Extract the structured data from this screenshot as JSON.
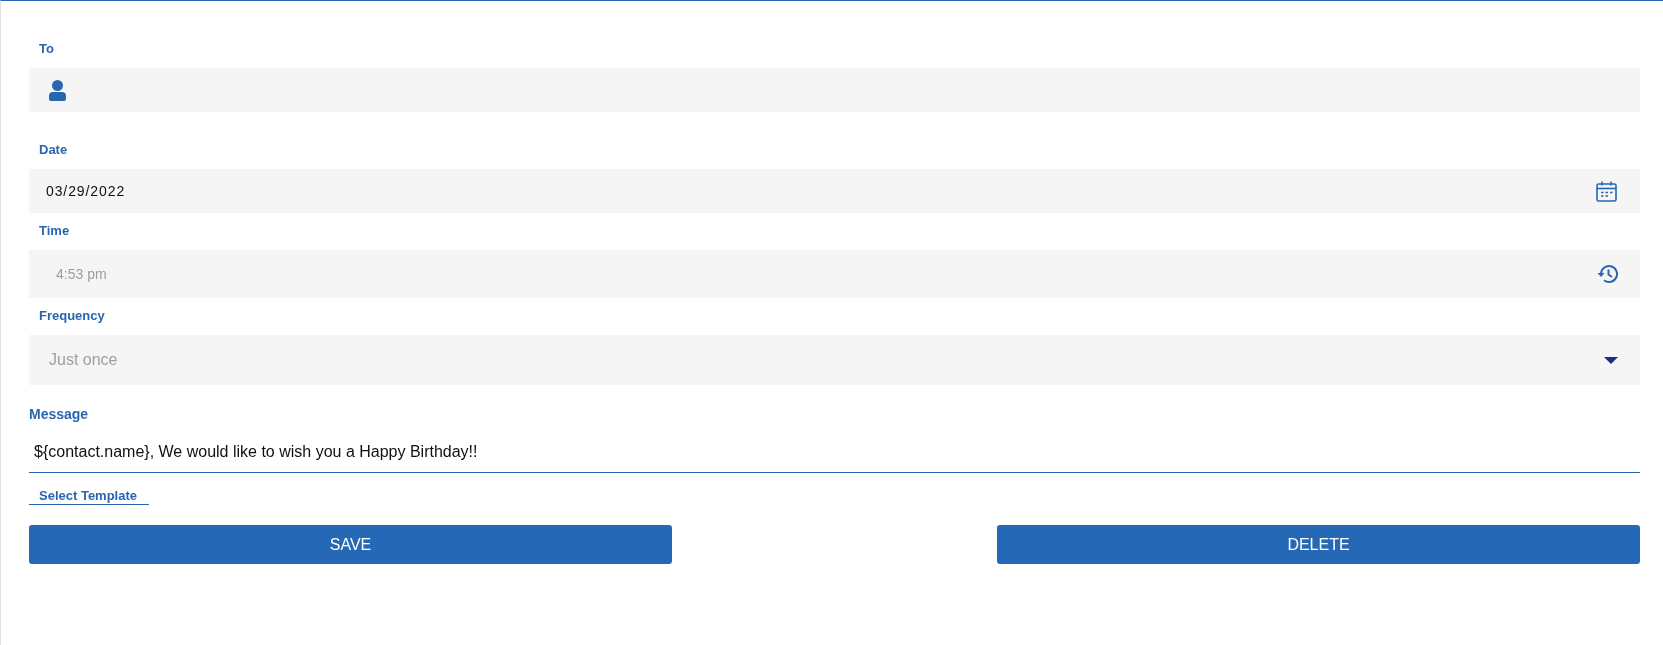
{
  "fields": [
    {
      "kind": "contact",
      "label": "To"
    },
    {
      "kind": "date",
      "label": "Date",
      "value": "03/29/2022"
    },
    {
      "kind": "time",
      "label": "Time",
      "placeholder": "4:53 pm"
    },
    {
      "kind": "select",
      "label": "Frequency",
      "value": "Just once"
    }
  ],
  "message": {
    "label": "Message",
    "value": "${contact.name}, We would like to wish you a Happy Birthday!!"
  },
  "template_link": "Select Template",
  "buttons": [
    "SAVE",
    "DELETE"
  ]
}
